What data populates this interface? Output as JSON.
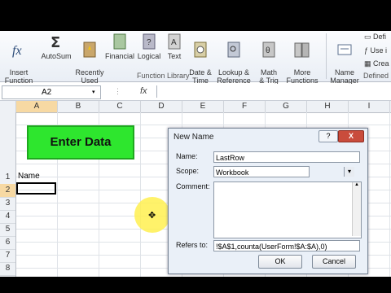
{
  "ribbon": {
    "insert_function": "Insert\nFunction",
    "autosum": "AutoSum",
    "recently_used": "Recently\nUsed",
    "financial": "Financial",
    "logical": "Logical",
    "text": "Text",
    "date_time": "Date &\nTime",
    "lookup": "Lookup &\nReference",
    "math": "Math\n& Trig",
    "more": "More\nFunctions",
    "name_manager": "Name\nManager",
    "define": "Defi",
    "use_in": "Use i",
    "create": "Crea",
    "group_function_library": "Function Library",
    "group_defined": "Defined"
  },
  "formula_bar": {
    "name_box": "A2",
    "fx": "fx",
    "formula": ""
  },
  "columns": [
    "A",
    "B",
    "C",
    "D",
    "E",
    "F",
    "G",
    "H",
    "I"
  ],
  "rows": [
    "1",
    "2",
    "3",
    "4",
    "5",
    "6",
    "7",
    "8"
  ],
  "sheet": {
    "button_label": "Enter Data",
    "a1": "Name"
  },
  "dialog": {
    "title": "New Name",
    "help": "?",
    "close": "X",
    "name_label": "Name:",
    "name_value": "LastRow",
    "scope_label": "Scope:",
    "scope_value": "Workbook",
    "comment_label": "Comment:",
    "refers_label": "Refers to:",
    "refers_value": "!$A$1,counta(UserForm!$A:$A),0)",
    "ok": "OK",
    "cancel": "Cancel"
  },
  "colors": {
    "button_green": "#2ee62e",
    "selected_header": "#f7d9a3",
    "cursor_highlight": "#fff050"
  }
}
